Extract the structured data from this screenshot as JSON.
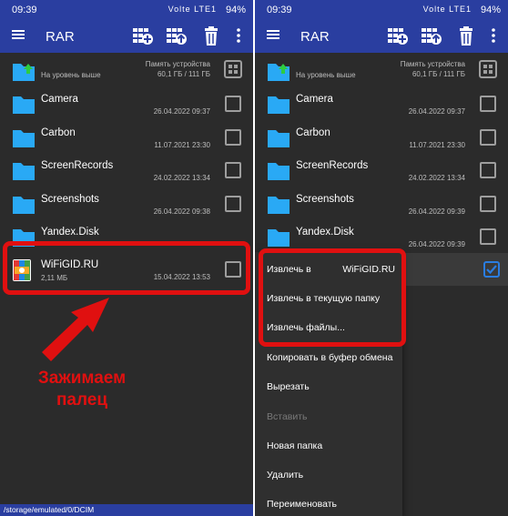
{
  "left": {
    "status": {
      "time": "09:39",
      "net_icons": "Volte LTE1",
      "battery": "94%"
    },
    "toolbar": {
      "title": "RAR"
    },
    "up_row": {
      "label": "На уровень выше",
      "storage_name": "Память устройства",
      "storage_size": "60,1 ГБ / 111 ГБ"
    },
    "folders": [
      {
        "name": "Camera",
        "date": "26.04.2022 09:37"
      },
      {
        "name": "Carbon",
        "date": "11.07.2021 23:30"
      },
      {
        "name": "ScreenRecords",
        "date": "24.02.2022 13:34"
      },
      {
        "name": "Screenshots",
        "date": "26.04.2022 09:38"
      },
      {
        "name": "Yandex.Disk",
        "date": ""
      }
    ],
    "file": {
      "name": "WiFiGID.RU",
      "size": "2,11 МБ",
      "date": "15.04.2022 13:53"
    },
    "annotation": {
      "line1": "Зажимаем",
      "line2": "палец"
    },
    "path": "/storage/emulated/0/DCIM"
  },
  "right": {
    "status": {
      "time": "09:39",
      "net_icons": "Volte LTE1",
      "battery": "94%"
    },
    "toolbar": {
      "title": "RAR"
    },
    "up_row": {
      "label": "На уровень выше",
      "storage_name": "Память устройства",
      "storage_size": "60,1 ГБ / 111 ГБ"
    },
    "folders": [
      {
        "name": "Camera",
        "date": "26.04.2022 09:37"
      },
      {
        "name": "Carbon",
        "date": "11.07.2021 23:30"
      },
      {
        "name": "ScreenRecords",
        "date": "24.02.2022 13:34"
      },
      {
        "name": "Screenshots",
        "date": "26.04.2022 09:39"
      },
      {
        "name": "Yandex.Disk",
        "date": "26.04.2022 09:39"
      }
    ],
    "context_menu": {
      "extract_to_label": "Извлечь в",
      "extract_to_target": "WiFiGID.RU",
      "items": [
        "Извлечь в текущую папку",
        "Извлечь файлы...",
        "Копировать в буфер обмена",
        "Вырезать",
        "Вставить",
        "Новая папка",
        "Удалить",
        "Переименовать"
      ]
    }
  },
  "colors": {
    "toolbar": "#2a3ea0",
    "background": "#2b2b2b",
    "highlight": "#e01010",
    "folder": "#29a9f5",
    "checkbox_checked": "#2a7de1"
  }
}
